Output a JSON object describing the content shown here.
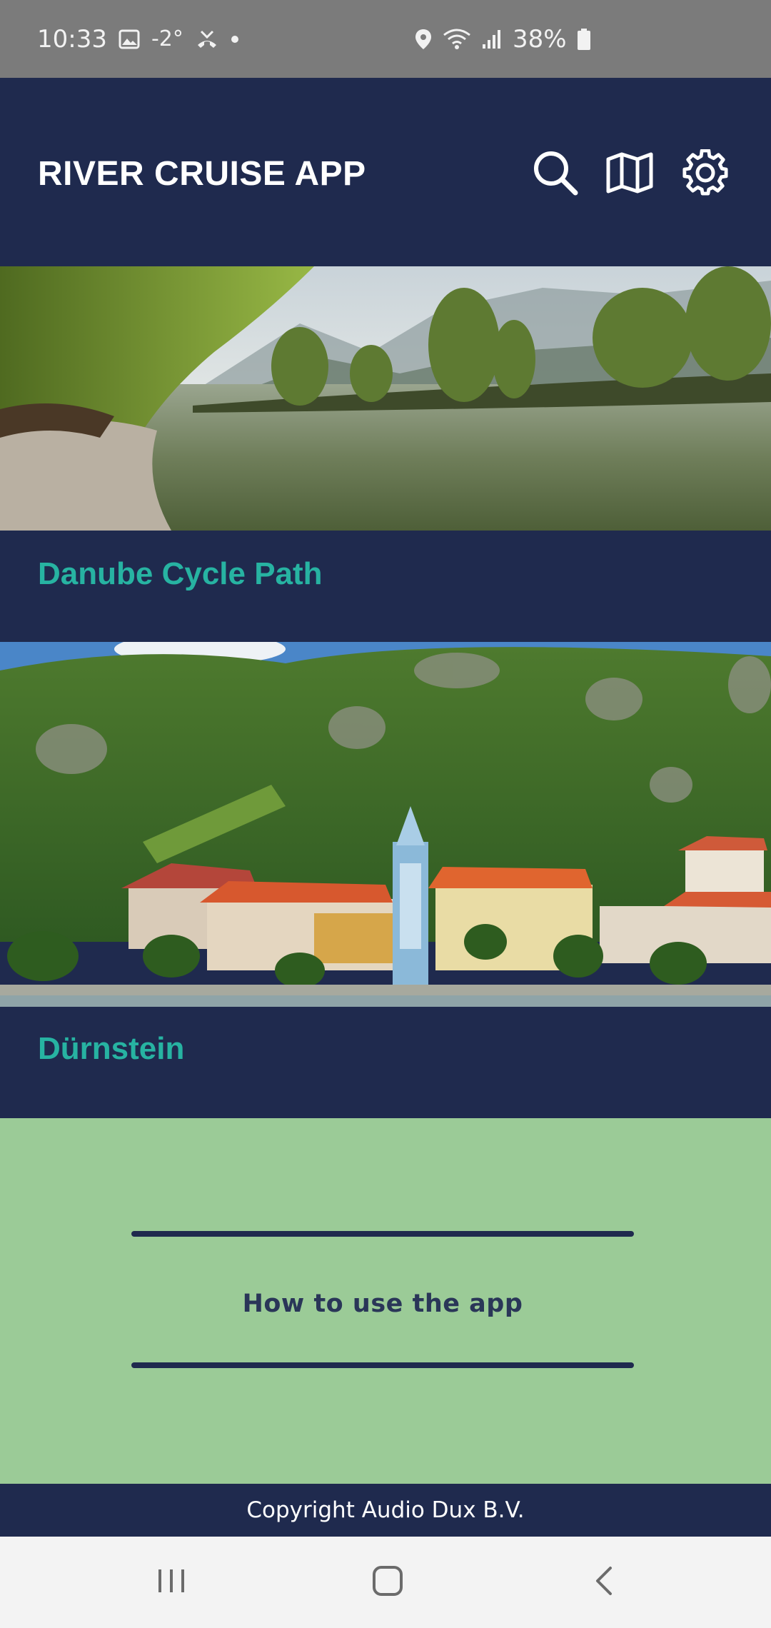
{
  "status_bar": {
    "time": "10:33",
    "temperature": "-2°",
    "battery": "38%",
    "icons": [
      "image-icon",
      "missed-call-icon",
      "dot-icon",
      "location-icon",
      "wifi-icon",
      "signal-icon",
      "battery-icon"
    ]
  },
  "header": {
    "title": "RIVER CRUISE APP",
    "actions": [
      "search-icon",
      "map-icon",
      "gear-icon"
    ]
  },
  "cards": [
    {
      "title": "Danube Cycle Path"
    },
    {
      "title": "Dürnstein"
    }
  ],
  "how_to": {
    "label": "How to use the app"
  },
  "footer": {
    "copyright": "Copyright Audio Dux B.V."
  },
  "nav": {
    "buttons": [
      "recent-apps-icon",
      "home-icon",
      "back-icon"
    ]
  },
  "colors": {
    "header_bg": "#1f2a4e",
    "accent_teal": "#27b3a2",
    "howto_bg": "#9bcb97",
    "status_bar_bg": "#7b7b7b"
  }
}
